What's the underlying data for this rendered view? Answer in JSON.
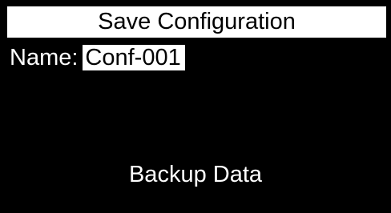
{
  "screen": {
    "title": "Save Configuration",
    "name_label": "Name:",
    "name_value": "Conf-001",
    "action_label": "Backup Data"
  },
  "colors": {
    "background": "#000000",
    "foreground": "#ffffff",
    "highlight_text": "#000000"
  }
}
